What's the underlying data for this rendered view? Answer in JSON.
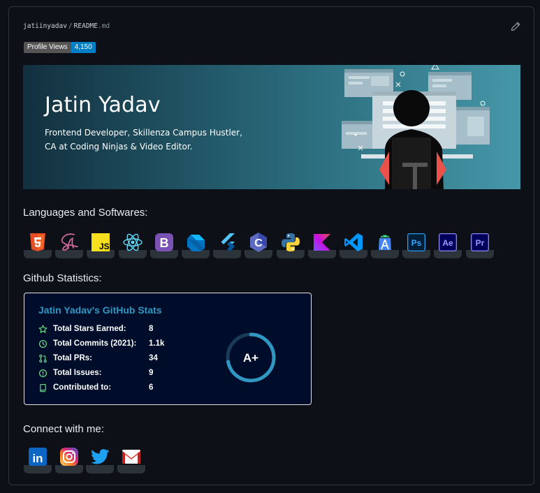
{
  "file_path": {
    "owner": "jatiinyadav",
    "separator": "/",
    "filename": "README",
    "extension": ".md"
  },
  "badge": {
    "label": "Profile Views",
    "value": "4,150"
  },
  "banner": {
    "name": "Jatin Yadav",
    "subtitle_line1": "Frontend Developer, Skillenza Campus Hustler,",
    "subtitle_line2": "CA at Coding Ninjas  & Video Editor."
  },
  "sections": {
    "languages": "Languages and Softwares:",
    "github": "Github Statistics:",
    "connect": "Connect with me:"
  },
  "tools": [
    "html5-icon",
    "sass-icon",
    "javascript-icon",
    "react-icon",
    "bootstrap-icon",
    "dart-icon",
    "flutter-icon",
    "c-icon",
    "python-icon",
    "kotlin-icon",
    "vscode-icon",
    "android-studio-icon",
    "photoshop-icon",
    "after-effects-icon",
    "premiere-icon"
  ],
  "tool_labels": {
    "js": "JS",
    "bootstrap": "B",
    "c": "C",
    "ps": "Ps",
    "ae": "Ae",
    "pr": "Pr"
  },
  "stats": {
    "title": "Jatin Yadav's GitHub Stats",
    "rows": [
      {
        "label": "Total Stars Earned:",
        "value": "8"
      },
      {
        "label": "Total Commits (2021):",
        "value": "1.1k"
      },
      {
        "label": "Total PRs:",
        "value": "34"
      },
      {
        "label": "Total Issues:",
        "value": "9"
      },
      {
        "label": "Contributed to:",
        "value": "6"
      }
    ],
    "rank": "A+",
    "rank_progress": 0.72
  },
  "social": [
    "linkedin-icon",
    "instagram-icon",
    "twitter-icon",
    "gmail-icon"
  ],
  "social_labels": {
    "linkedin": "in"
  },
  "colors": {
    "accent": "#2f97c1",
    "background": "#0d1117",
    "stats_bg": "#000d2a",
    "rank_ring": "#2f97c1"
  }
}
